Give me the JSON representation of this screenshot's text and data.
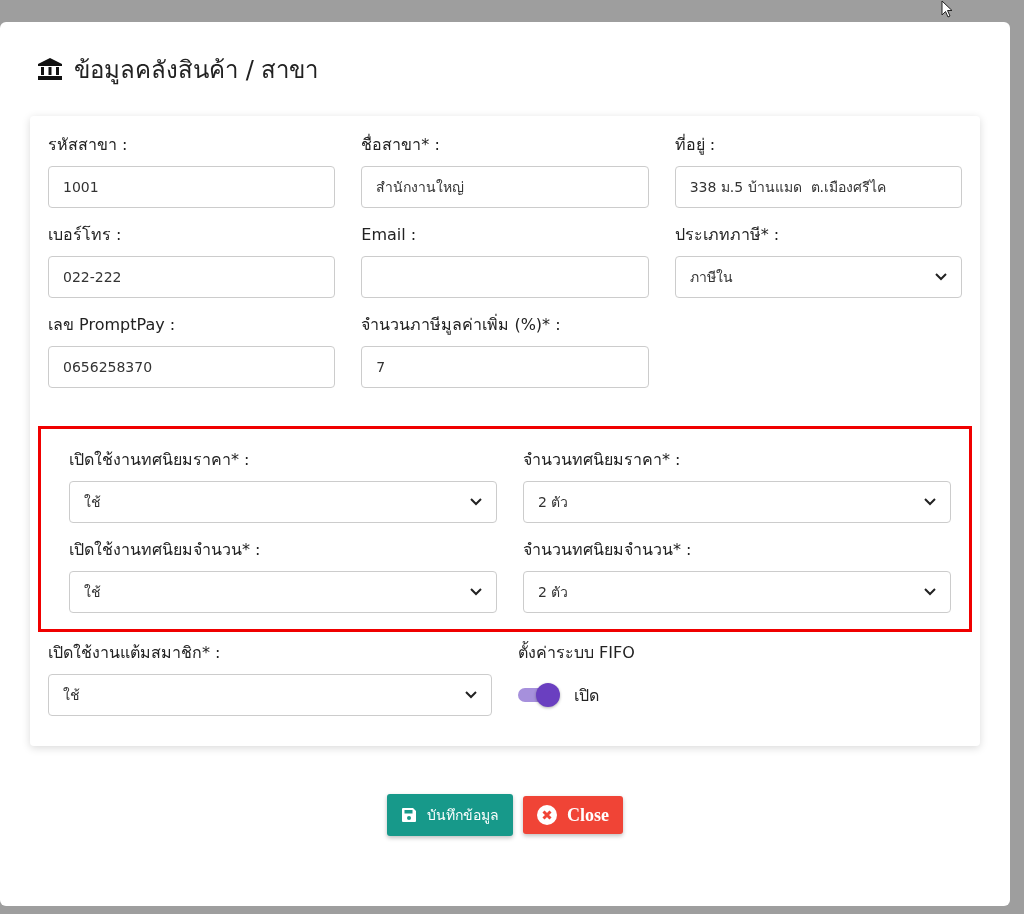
{
  "dialog": {
    "title": "ข้อมูลคลังสินค้า / สาขา"
  },
  "fields": [
    {
      "label": "รหัสสาขา :",
      "kind": "text",
      "value": "1001"
    },
    {
      "label": "ชื่อสาขา* :",
      "kind": "text",
      "value": "สำนักงานใหญ่"
    },
    {
      "label": "ที่อยู่ :",
      "kind": "text",
      "value": "338 ม.5 บ้านแมด  ต.เมืองศรีไค"
    },
    {
      "label": "เบอร์โทร :",
      "kind": "text",
      "value": "022-222"
    },
    {
      "label": "Email :",
      "kind": "text"
    },
    {
      "label": "ประเภทภาษี* :",
      "kind": "select",
      "value": "ภาษีใน"
    },
    {
      "label": "เลข PromptPay :",
      "kind": "text",
      "value": "0656258370"
    },
    {
      "label": "จำนวนภาษีมูลค่าเพิ่ม (%)* :",
      "kind": "text",
      "value": "7"
    }
  ],
  "decimal_settings": {
    "highlighted": true,
    "fields": [
      {
        "label": "เปิดใช้งานทศนิยมราคา* :",
        "kind": "select",
        "value": "ใช้"
      },
      {
        "label": "จำนวนทศนิยมราคา* :",
        "kind": "select",
        "value": "2 ตัว"
      },
      {
        "label": "เปิดใช้งานทศนิยมจำนวน* :",
        "kind": "select",
        "value": "ใช้"
      },
      {
        "label": "จำนวนทศนิยมจำนวน* :",
        "kind": "select",
        "value": "2 ตัว"
      }
    ]
  },
  "member_points": {
    "label": "เปิดใช้งานแต้มสมาชิก* :",
    "value": "ใช้"
  },
  "fifo": {
    "label": "ตั้งค่าระบบ FIFO",
    "on": true,
    "state_label": "เปิด"
  },
  "buttons": [
    {
      "label": "บันทึกข้อมูล",
      "kind": "save"
    },
    {
      "label": "Close",
      "kind": "close"
    }
  ]
}
